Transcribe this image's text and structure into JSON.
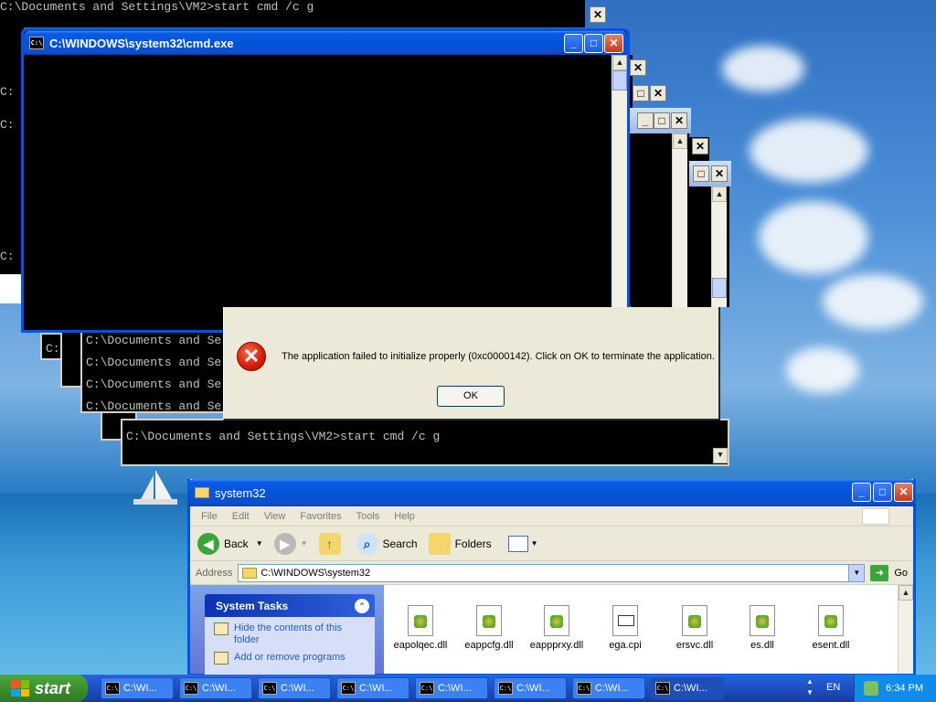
{
  "cmd_window": {
    "title": "C:\\WINDOWS\\system32\\cmd.exe",
    "min": "_",
    "max": "□",
    "close": "✕"
  },
  "console_lines": {
    "top": "C:\\Documents and Settings\\VM2>start cmd /c g",
    "left_a": "C:",
    "left_b": "C:",
    "left_c": "C:",
    "stack1": "C:\\Documents and Se",
    "stack2": "C:\\Documents and Se",
    "stack3": "C:\\Documents and Se",
    "stack4": "C:\\Documents and Se",
    "stack_small": "C:",
    "bottom": "C:\\Documents and Settings\\VM2>start cmd /c g"
  },
  "error_dialog": {
    "message": "The application failed to initialize properly (0xc0000142). Click on OK to terminate the application.",
    "ok_label": "OK",
    "icon_glyph": "✕"
  },
  "explorer": {
    "title": "system32",
    "menu": [
      "File",
      "Edit",
      "View",
      "Favorites",
      "Tools",
      "Help"
    ],
    "toolbar": {
      "back": "Back",
      "search": "Search",
      "folders": "Folders"
    },
    "address_label": "Address",
    "address_value": "C:\\WINDOWS\\system32",
    "go_label": "Go",
    "system_tasks": {
      "title": "System Tasks",
      "items": [
        "Hide the contents of this folder",
        "Add or remove programs"
      ]
    },
    "files": [
      "eapolqec.dll",
      "eappcfg.dll",
      "eappprxy.dll",
      "ega.cpi",
      "ersvc.dll",
      "es.dll",
      "esent.dll"
    ]
  },
  "taskbar": {
    "start_label": "start",
    "tasks": [
      "C:\\WI...",
      "C:\\WI...",
      "C:\\WI...",
      "C:\\WI...",
      "C:\\WI...",
      "C:\\WI...",
      "C:\\WI...",
      "C:\\WI..."
    ],
    "lang": "EN",
    "clock": "6:34 PM"
  },
  "colors": {
    "title_blue": "#0a5ae6",
    "close_red": "#c53a1a",
    "console_bg": "#000000",
    "console_text": "#c0c0c0",
    "start_green": "#3c8f2f"
  }
}
